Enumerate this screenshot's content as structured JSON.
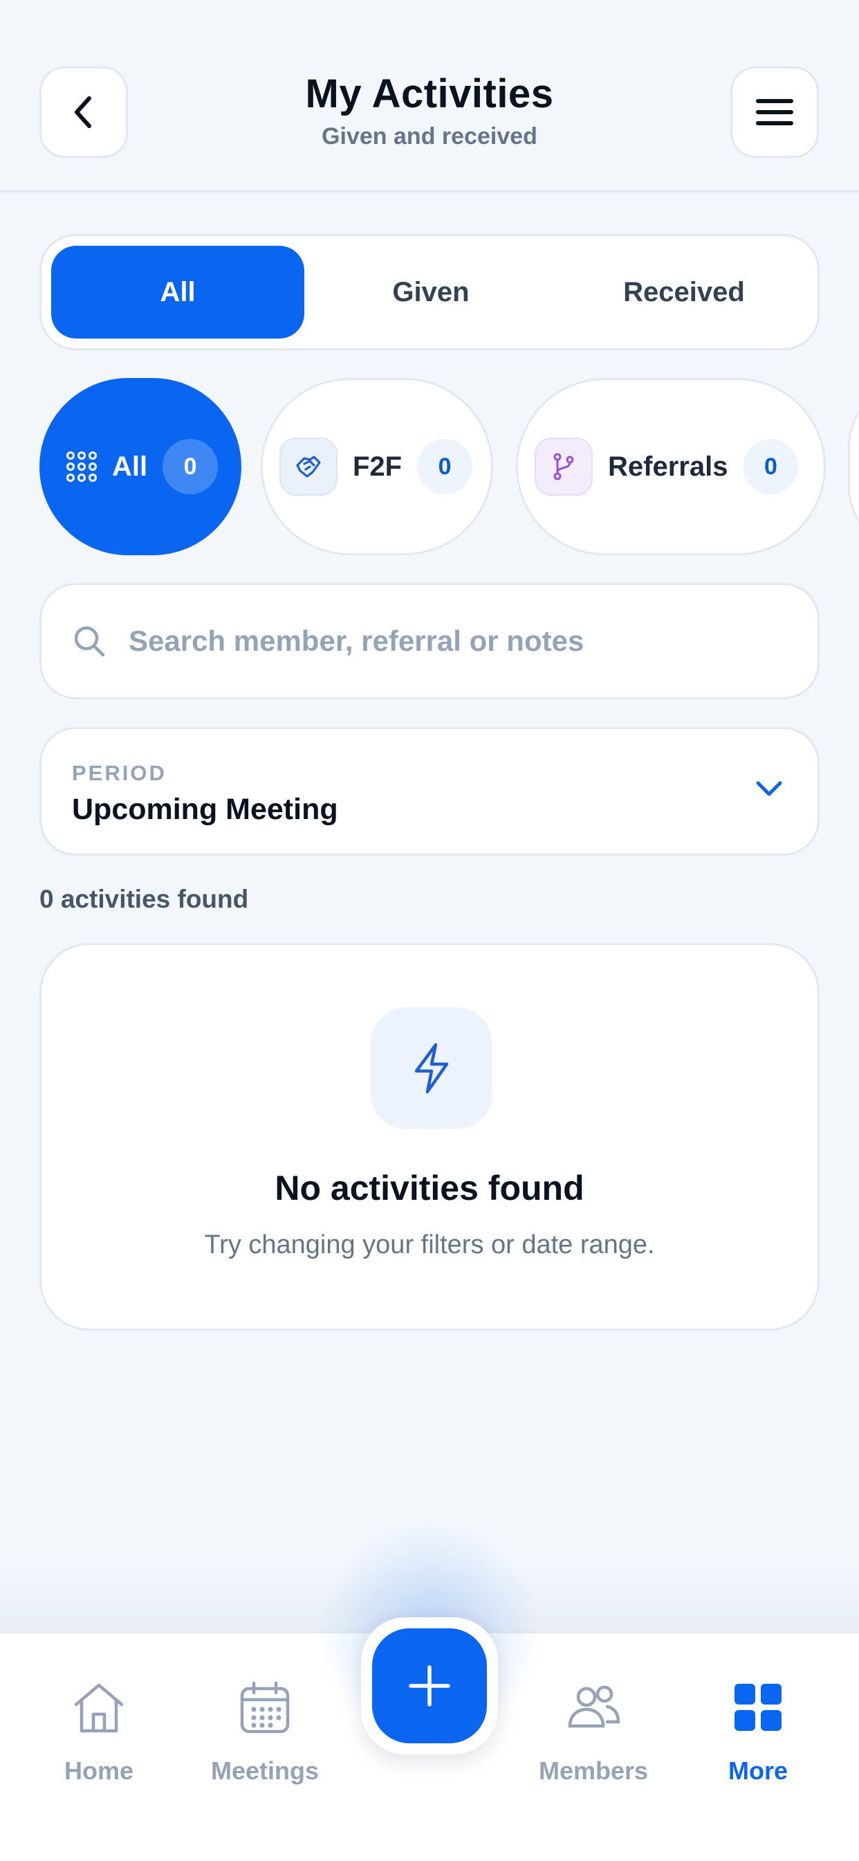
{
  "header": {
    "title": "My Activities",
    "subtitle": "Given and received"
  },
  "tabs": [
    {
      "label": "All",
      "active": true
    },
    {
      "label": "Given",
      "active": false
    },
    {
      "label": "Received",
      "active": false
    }
  ],
  "filters": [
    {
      "label": "All",
      "count": "0",
      "icon": "grid-dots-icon",
      "active": true
    },
    {
      "label": "F2F",
      "count": "0",
      "icon": "handshake-icon",
      "active": false
    },
    {
      "label": "Referrals",
      "count": "0",
      "icon": "branch-icon",
      "active": false
    }
  ],
  "search": {
    "placeholder": "Search member, referral or notes",
    "value": ""
  },
  "period": {
    "label": "PERIOD",
    "value": "Upcoming Meeting"
  },
  "results": {
    "count_text": "0 activities found"
  },
  "empty_state": {
    "title": "No activities found",
    "subtitle": "Try changing your filters or date range.",
    "icon": "lightning-icon"
  },
  "nav": {
    "items": [
      {
        "label": "Home",
        "icon": "home-icon",
        "active": false
      },
      {
        "label": "Meetings",
        "icon": "calendar-icon",
        "active": false
      },
      {
        "label": "Members",
        "icon": "users-icon",
        "active": false
      },
      {
        "label": "More",
        "icon": "grid-icon",
        "active": true
      }
    ],
    "fab_icon": "plus-icon"
  },
  "colors": {
    "accent": "#0a66f0",
    "background": "#f3f7fc",
    "muted_text": "#94a3b8",
    "referral_icon": "#9b4fd6"
  }
}
